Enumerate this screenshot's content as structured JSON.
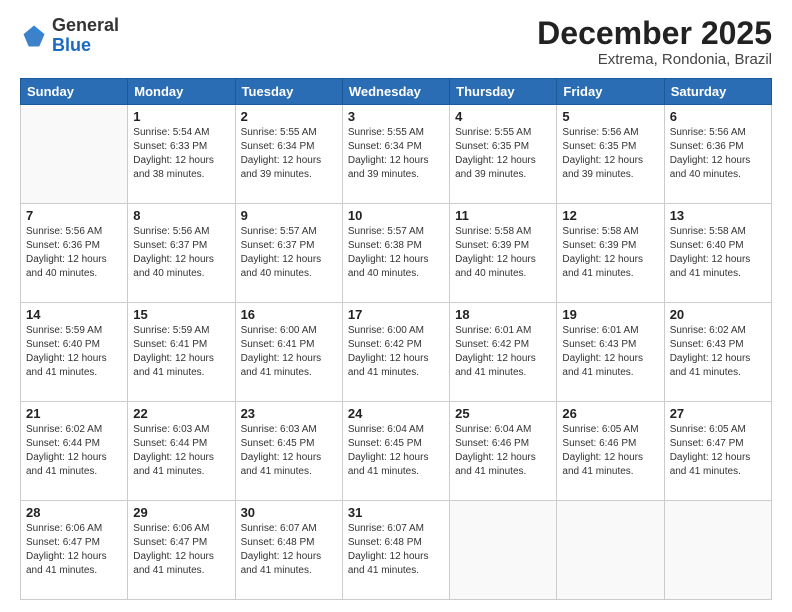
{
  "header": {
    "logo_general": "General",
    "logo_blue": "Blue",
    "month_title": "December 2025",
    "subtitle": "Extrema, Rondonia, Brazil"
  },
  "weekdays": [
    "Sunday",
    "Monday",
    "Tuesday",
    "Wednesday",
    "Thursday",
    "Friday",
    "Saturday"
  ],
  "weeks": [
    [
      {
        "day": "",
        "info": ""
      },
      {
        "day": "1",
        "info": "Sunrise: 5:54 AM\nSunset: 6:33 PM\nDaylight: 12 hours\nand 38 minutes."
      },
      {
        "day": "2",
        "info": "Sunrise: 5:55 AM\nSunset: 6:34 PM\nDaylight: 12 hours\nand 39 minutes."
      },
      {
        "day": "3",
        "info": "Sunrise: 5:55 AM\nSunset: 6:34 PM\nDaylight: 12 hours\nand 39 minutes."
      },
      {
        "day": "4",
        "info": "Sunrise: 5:55 AM\nSunset: 6:35 PM\nDaylight: 12 hours\nand 39 minutes."
      },
      {
        "day": "5",
        "info": "Sunrise: 5:56 AM\nSunset: 6:35 PM\nDaylight: 12 hours\nand 39 minutes."
      },
      {
        "day": "6",
        "info": "Sunrise: 5:56 AM\nSunset: 6:36 PM\nDaylight: 12 hours\nand 40 minutes."
      }
    ],
    [
      {
        "day": "7",
        "info": "Sunrise: 5:56 AM\nSunset: 6:36 PM\nDaylight: 12 hours\nand 40 minutes."
      },
      {
        "day": "8",
        "info": "Sunrise: 5:56 AM\nSunset: 6:37 PM\nDaylight: 12 hours\nand 40 minutes."
      },
      {
        "day": "9",
        "info": "Sunrise: 5:57 AM\nSunset: 6:37 PM\nDaylight: 12 hours\nand 40 minutes."
      },
      {
        "day": "10",
        "info": "Sunrise: 5:57 AM\nSunset: 6:38 PM\nDaylight: 12 hours\nand 40 minutes."
      },
      {
        "day": "11",
        "info": "Sunrise: 5:58 AM\nSunset: 6:39 PM\nDaylight: 12 hours\nand 40 minutes."
      },
      {
        "day": "12",
        "info": "Sunrise: 5:58 AM\nSunset: 6:39 PM\nDaylight: 12 hours\nand 41 minutes."
      },
      {
        "day": "13",
        "info": "Sunrise: 5:58 AM\nSunset: 6:40 PM\nDaylight: 12 hours\nand 41 minutes."
      }
    ],
    [
      {
        "day": "14",
        "info": "Sunrise: 5:59 AM\nSunset: 6:40 PM\nDaylight: 12 hours\nand 41 minutes."
      },
      {
        "day": "15",
        "info": "Sunrise: 5:59 AM\nSunset: 6:41 PM\nDaylight: 12 hours\nand 41 minutes."
      },
      {
        "day": "16",
        "info": "Sunrise: 6:00 AM\nSunset: 6:41 PM\nDaylight: 12 hours\nand 41 minutes."
      },
      {
        "day": "17",
        "info": "Sunrise: 6:00 AM\nSunset: 6:42 PM\nDaylight: 12 hours\nand 41 minutes."
      },
      {
        "day": "18",
        "info": "Sunrise: 6:01 AM\nSunset: 6:42 PM\nDaylight: 12 hours\nand 41 minutes."
      },
      {
        "day": "19",
        "info": "Sunrise: 6:01 AM\nSunset: 6:43 PM\nDaylight: 12 hours\nand 41 minutes."
      },
      {
        "day": "20",
        "info": "Sunrise: 6:02 AM\nSunset: 6:43 PM\nDaylight: 12 hours\nand 41 minutes."
      }
    ],
    [
      {
        "day": "21",
        "info": "Sunrise: 6:02 AM\nSunset: 6:44 PM\nDaylight: 12 hours\nand 41 minutes."
      },
      {
        "day": "22",
        "info": "Sunrise: 6:03 AM\nSunset: 6:44 PM\nDaylight: 12 hours\nand 41 minutes."
      },
      {
        "day": "23",
        "info": "Sunrise: 6:03 AM\nSunset: 6:45 PM\nDaylight: 12 hours\nand 41 minutes."
      },
      {
        "day": "24",
        "info": "Sunrise: 6:04 AM\nSunset: 6:45 PM\nDaylight: 12 hours\nand 41 minutes."
      },
      {
        "day": "25",
        "info": "Sunrise: 6:04 AM\nSunset: 6:46 PM\nDaylight: 12 hours\nand 41 minutes."
      },
      {
        "day": "26",
        "info": "Sunrise: 6:05 AM\nSunset: 6:46 PM\nDaylight: 12 hours\nand 41 minutes."
      },
      {
        "day": "27",
        "info": "Sunrise: 6:05 AM\nSunset: 6:47 PM\nDaylight: 12 hours\nand 41 minutes."
      }
    ],
    [
      {
        "day": "28",
        "info": "Sunrise: 6:06 AM\nSunset: 6:47 PM\nDaylight: 12 hours\nand 41 minutes."
      },
      {
        "day": "29",
        "info": "Sunrise: 6:06 AM\nSunset: 6:47 PM\nDaylight: 12 hours\nand 41 minutes."
      },
      {
        "day": "30",
        "info": "Sunrise: 6:07 AM\nSunset: 6:48 PM\nDaylight: 12 hours\nand 41 minutes."
      },
      {
        "day": "31",
        "info": "Sunrise: 6:07 AM\nSunset: 6:48 PM\nDaylight: 12 hours\nand 41 minutes."
      },
      {
        "day": "",
        "info": ""
      },
      {
        "day": "",
        "info": ""
      },
      {
        "day": "",
        "info": ""
      }
    ]
  ]
}
